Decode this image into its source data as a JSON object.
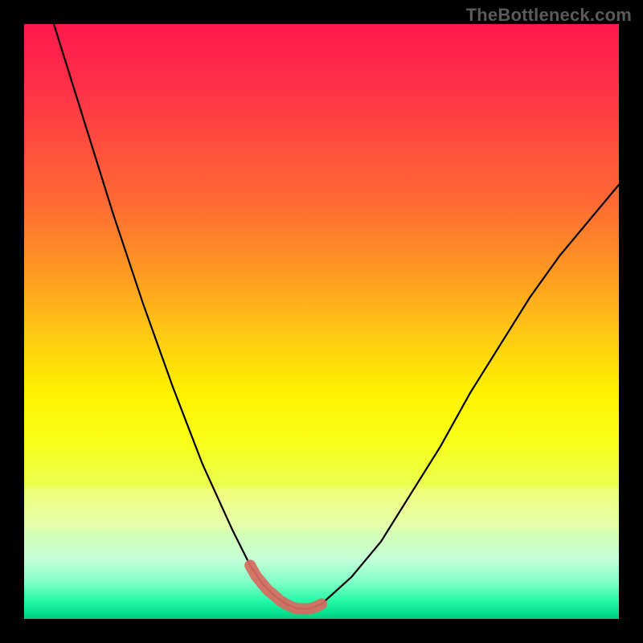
{
  "watermark": "TheBottleneck.com",
  "colors": {
    "frame": "#000000",
    "curve": "#000000",
    "trough_marker": "#d9695f",
    "gradient_top": "#ff1a4d",
    "gradient_bottom": "#03c97e"
  },
  "chart_data": {
    "type": "line",
    "title": "",
    "xlabel": "",
    "ylabel": "",
    "xlim": [
      0,
      100
    ],
    "ylim": [
      0,
      100
    ],
    "grid": false,
    "legend": false,
    "note": "Unlabeled V-shaped bottleneck curve over a vertical rainbow gradient; y read top-to-bottom with 0 at top. Values estimated from pixels.",
    "series": [
      {
        "name": "curve",
        "x": [
          5,
          10,
          15,
          20,
          25,
          30,
          35,
          38,
          40,
          42,
          44,
          46,
          48,
          50,
          55,
          60,
          65,
          70,
          75,
          80,
          85,
          90,
          95,
          100
        ],
        "y": [
          0,
          16,
          32,
          47,
          61,
          74,
          85,
          91,
          94,
          96,
          97.5,
          98.3,
          98.3,
          97.5,
          93,
          87,
          79,
          71,
          62,
          54,
          46,
          39,
          33,
          27
        ]
      },
      {
        "name": "trough_marker",
        "x": [
          38,
          39,
          40,
          41,
          42,
          43,
          44,
          45,
          46,
          47,
          48,
          49,
          50
        ],
        "y": [
          91,
          92.8,
          94,
          95.2,
          96,
          96.9,
          97.5,
          98,
          98.3,
          98.3,
          98.3,
          98,
          97.5
        ]
      }
    ],
    "gradient_color_scale": {
      "orientation": "vertical",
      "stops": [
        {
          "pos": 0.0,
          "hex": "#ff1a4d"
        },
        {
          "pos": 0.3,
          "hex": "#ff6a33"
        },
        {
          "pos": 0.62,
          "hex": "#fff200"
        },
        {
          "pos": 0.9,
          "hex": "#c4ffd8"
        },
        {
          "pos": 1.0,
          "hex": "#03c97e"
        }
      ]
    }
  }
}
